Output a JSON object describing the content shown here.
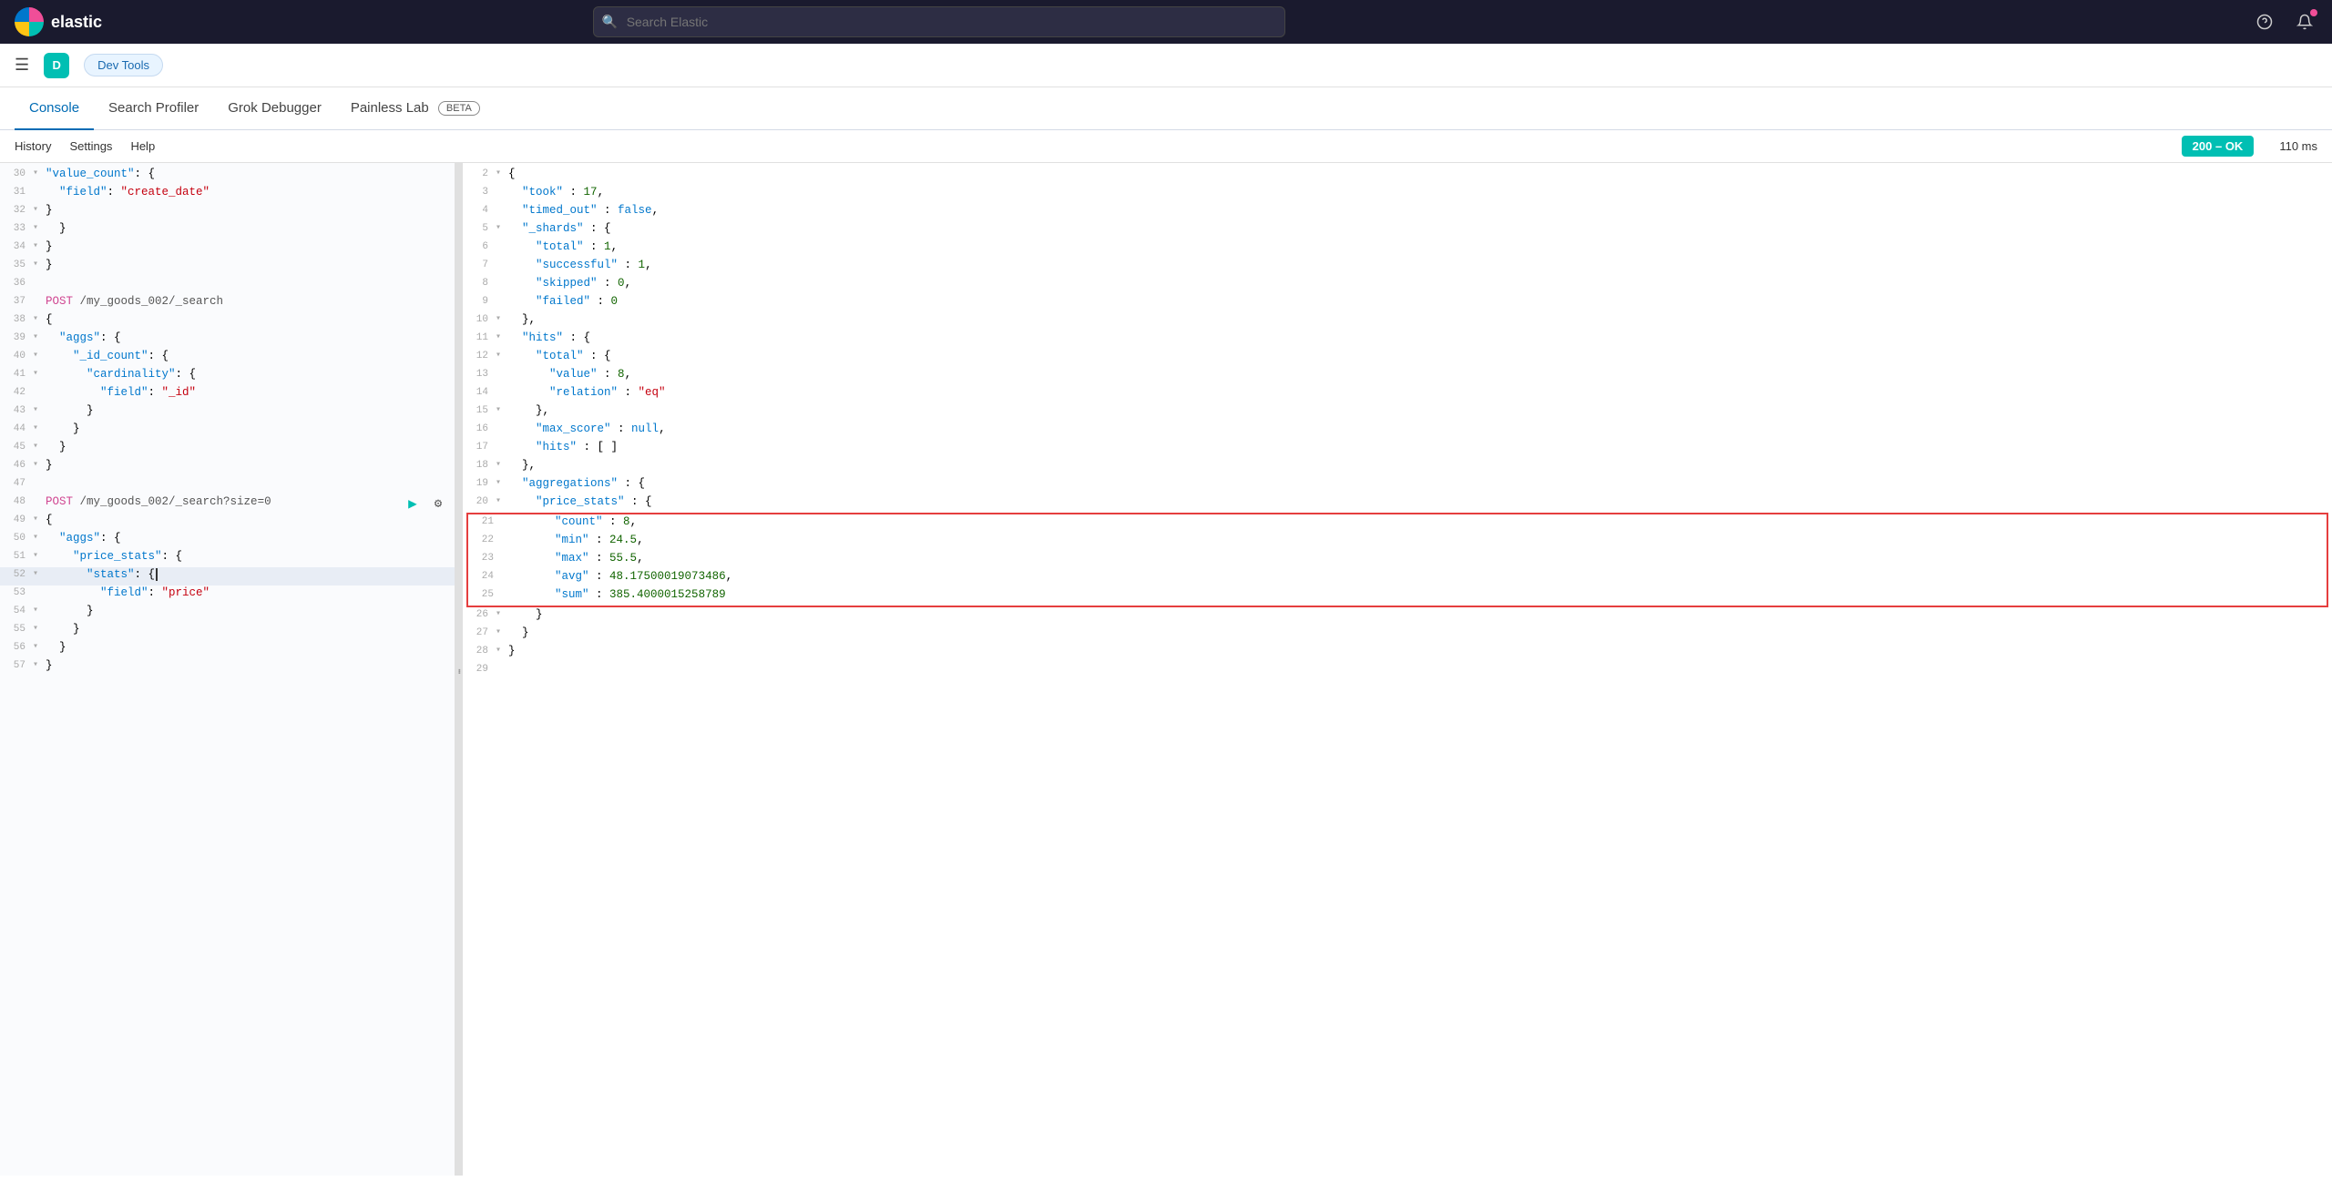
{
  "nav": {
    "logo_text": "elastic",
    "search_placeholder": "Search Elastic",
    "user_initial": "D",
    "dev_tools_label": "Dev Tools"
  },
  "tabs": {
    "items": [
      {
        "label": "Console",
        "active": true
      },
      {
        "label": "Search Profiler",
        "active": false
      },
      {
        "label": "Grok Debugger",
        "active": false
      },
      {
        "label": "Painless Lab",
        "active": false
      }
    ],
    "beta_label": "BETA"
  },
  "toolbar": {
    "history_label": "History",
    "settings_label": "Settings",
    "help_label": "Help",
    "status_label": "200 – OK",
    "time_label": "110 ms"
  },
  "editor": {
    "lines": [
      {
        "num": "30",
        "fold": "▾",
        "text": "    \"value_count\": {",
        "class": ""
      },
      {
        "num": "31",
        "fold": " ",
        "text": "      \"field\": \"create_date\"",
        "class": ""
      },
      {
        "num": "32",
        "fold": "▾",
        "text": "    }",
        "class": ""
      },
      {
        "num": "33",
        "fold": "▾",
        "text": "  }",
        "class": ""
      },
      {
        "num": "34",
        "fold": "▾",
        "text": "}",
        "class": ""
      },
      {
        "num": "35",
        "fold": "▾",
        "text": "}",
        "class": ""
      },
      {
        "num": "36",
        "fold": " ",
        "text": "",
        "class": ""
      },
      {
        "num": "37",
        "fold": " ",
        "text": "POST /my_goods_002/_search",
        "class": "method-line"
      },
      {
        "num": "38",
        "fold": "▾",
        "text": "{",
        "class": ""
      },
      {
        "num": "39",
        "fold": "▾",
        "text": "  \"aggs\": {",
        "class": ""
      },
      {
        "num": "40",
        "fold": "▾",
        "text": "    \"_id_count\": {",
        "class": ""
      },
      {
        "num": "41",
        "fold": "▾",
        "text": "      \"cardinality\": {",
        "class": ""
      },
      {
        "num": "42",
        "fold": " ",
        "text": "        \"field\": \"_id\"",
        "class": ""
      },
      {
        "num": "43",
        "fold": "▾",
        "text": "      }",
        "class": ""
      },
      {
        "num": "44",
        "fold": "▾",
        "text": "    }",
        "class": ""
      },
      {
        "num": "45",
        "fold": "▾",
        "text": "  }",
        "class": ""
      },
      {
        "num": "46",
        "fold": "▾",
        "text": "}",
        "class": ""
      },
      {
        "num": "47",
        "fold": " ",
        "text": "",
        "class": ""
      },
      {
        "num": "48",
        "fold": " ",
        "text": "POST /my_goods_002/_search?size=0",
        "class": "method-line has-actions"
      },
      {
        "num": "49",
        "fold": "▾",
        "text": "{",
        "class": ""
      },
      {
        "num": "50",
        "fold": "▾",
        "text": "  \"aggs\": {",
        "class": ""
      },
      {
        "num": "51",
        "fold": "▾",
        "text": "    \"price_stats\": {",
        "class": ""
      },
      {
        "num": "52",
        "fold": "▾",
        "text": "      \"stats\": {|",
        "class": "highlighted"
      },
      {
        "num": "53",
        "fold": " ",
        "text": "        \"field\": \"price\"",
        "class": ""
      },
      {
        "num": "54",
        "fold": "▾",
        "text": "      }",
        "class": ""
      },
      {
        "num": "55",
        "fold": "▾",
        "text": "    }",
        "class": ""
      },
      {
        "num": "56",
        "fold": "▾",
        "text": "  }",
        "class": ""
      },
      {
        "num": "57",
        "fold": "▾",
        "text": "}",
        "class": ""
      }
    ]
  },
  "response": {
    "lines": [
      {
        "num": "2",
        "fold": "▾",
        "text": "{",
        "normal": true
      },
      {
        "num": "3",
        "fold": " ",
        "text": "  \"took\" : 17,",
        "normal": true
      },
      {
        "num": "4",
        "fold": " ",
        "text": "  \"timed_out\" : false,",
        "normal": true
      },
      {
        "num": "5",
        "fold": "▾",
        "text": "  \"_shards\" : {",
        "normal": true
      },
      {
        "num": "6",
        "fold": " ",
        "text": "    \"total\" : 1,",
        "normal": true
      },
      {
        "num": "7",
        "fold": " ",
        "text": "    \"successful\" : 1,",
        "normal": true
      },
      {
        "num": "8",
        "fold": " ",
        "text": "    \"skipped\" : 0,",
        "normal": true
      },
      {
        "num": "9",
        "fold": " ",
        "text": "    \"failed\" : 0",
        "normal": true
      },
      {
        "num": "10",
        "fold": "▾",
        "text": "  },",
        "normal": true
      },
      {
        "num": "11",
        "fold": "▾",
        "text": "  \"hits\" : {",
        "normal": true
      },
      {
        "num": "12",
        "fold": "▾",
        "text": "    \"total\" : {",
        "normal": true
      },
      {
        "num": "13",
        "fold": " ",
        "text": "      \"value\" : 8,",
        "normal": true
      },
      {
        "num": "14",
        "fold": " ",
        "text": "      \"relation\" : \"eq\"",
        "normal": true
      },
      {
        "num": "15",
        "fold": "▾",
        "text": "    },",
        "normal": true
      },
      {
        "num": "16",
        "fold": " ",
        "text": "    \"max_score\" : null,",
        "normal": true
      },
      {
        "num": "17",
        "fold": " ",
        "text": "    \"hits\" : [ ]",
        "normal": true
      },
      {
        "num": "18",
        "fold": "▾",
        "text": "  },",
        "normal": true
      },
      {
        "num": "19",
        "fold": "▾",
        "text": "  \"aggregations\" : {",
        "normal": true
      },
      {
        "num": "20",
        "fold": "▾",
        "text": "    \"price_stats\" : {",
        "normal": true
      },
      {
        "num": "21",
        "fold": " ",
        "text": "      \"count\" : 8,",
        "highlighted": true
      },
      {
        "num": "22",
        "fold": " ",
        "text": "      \"min\" : 24.5,",
        "highlighted": true
      },
      {
        "num": "23",
        "fold": " ",
        "text": "      \"max\" : 55.5,",
        "highlighted": true
      },
      {
        "num": "24",
        "fold": " ",
        "text": "      \"avg\" : 48.17500019073486,",
        "highlighted": true
      },
      {
        "num": "25",
        "fold": " ",
        "text": "      \"sum\" : 385.4000015258789",
        "highlighted": true
      },
      {
        "num": "26",
        "fold": "▾",
        "text": "    }",
        "normal": true
      },
      {
        "num": "27",
        "fold": "▾",
        "text": "  }",
        "normal": true
      },
      {
        "num": "28",
        "fold": "▾",
        "text": "}",
        "normal": true
      },
      {
        "num": "29",
        "fold": " ",
        "text": "",
        "normal": true
      }
    ]
  }
}
